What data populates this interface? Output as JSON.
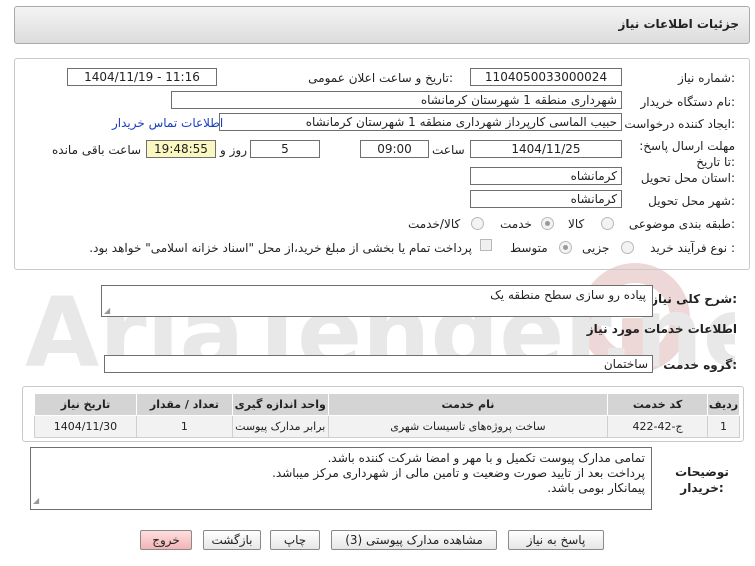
{
  "header": {
    "title": "جزئیات اطلاعات نیاز"
  },
  "info": {
    "need_number_label": "شماره نیاز:",
    "need_number": "1104050033000024",
    "announce_label": "تاریخ و ساعت اعلان عمومی:",
    "announce_value": "1404/11/19 - 11:16",
    "buyer_label": "نام دستگاه خریدار:",
    "buyer_value": "شهرداری منطقه 1 شهرستان کرمانشاه",
    "creator_label": "ایجاد کننده درخواست:",
    "creator_value": "حبیب الماسی کارپرداز شهرداری منطقه 1 شهرستان کرمانشاه",
    "contact_link": "اطلاعات تماس خریدار",
    "deadline_label": "مهلت ارسال پاسخ: تا تاریخ:",
    "deadline_date": "1404/11/25",
    "time_label": "ساعت",
    "deadline_time": "09:00",
    "days_value": "5",
    "days_label": "روز و",
    "remaining_time": "19:48:55",
    "remaining_label": "ساعت باقی مانده",
    "province_label": "استان محل تحویل:",
    "province_value": "کرمانشاه",
    "city_label": "شهر محل تحویل:",
    "city_value": "کرمانشاه",
    "category_label": "طبقه بندی موضوعی:",
    "category_options": [
      "کالا",
      "خدمت",
      "کالا/خدمت"
    ],
    "category_selected": "خدمت",
    "process_label": "نوع فرآیند خرید :",
    "process_options": [
      "جزیی",
      "متوسط"
    ],
    "process_selected": "متوسط",
    "payment_note": "پرداخت تمام یا بخشی از مبلغ خرید،از محل \"اسناد خزانه اسلامی\" خواهد بود."
  },
  "description": {
    "label": "شرح کلی نیاز:",
    "value": "پیاده رو سازی سطح منطقه یک"
  },
  "services": {
    "section_title": "اطلاعات خدمات مورد نیاز",
    "group_label": "گروه خدمت:",
    "group_value": "ساختمان",
    "columns": [
      "ردیف",
      "کد خدمت",
      "نام خدمت",
      "واحد اندازه گیری",
      "تعداد / مقدار",
      "تاریخ نیاز"
    ],
    "rows": [
      [
        "1",
        "ج-42-422",
        "ساخت پروژه‌های تاسیسات شهری",
        "برابر مدارک پیوست",
        "1",
        "1404/11/30"
      ]
    ]
  },
  "buyer_notes": {
    "label": "توضیحات خریدار:",
    "lines": [
      "تمامی مدارک پیوست تکمیل و با مهر و امضا شرکت کننده باشد.",
      "پرداخت بعد از تایید صورت وضعیت و تامین مالی از شهرداری مرکز میباشد.",
      "پیمانکار بومی باشد."
    ]
  },
  "buttons": {
    "reply": "پاسخ به نیاز",
    "attachments": "مشاهده مدارک پیوستی (3)",
    "print": "چاپ",
    "back": "بازگشت",
    "exit": "خروج"
  },
  "watermark": {
    "text": "AriaTender.neT"
  },
  "colors": {
    "link": "#1a3fbf",
    "remaining_bg": "#fbf7c0",
    "exit_bg": "#f3b4b4"
  }
}
